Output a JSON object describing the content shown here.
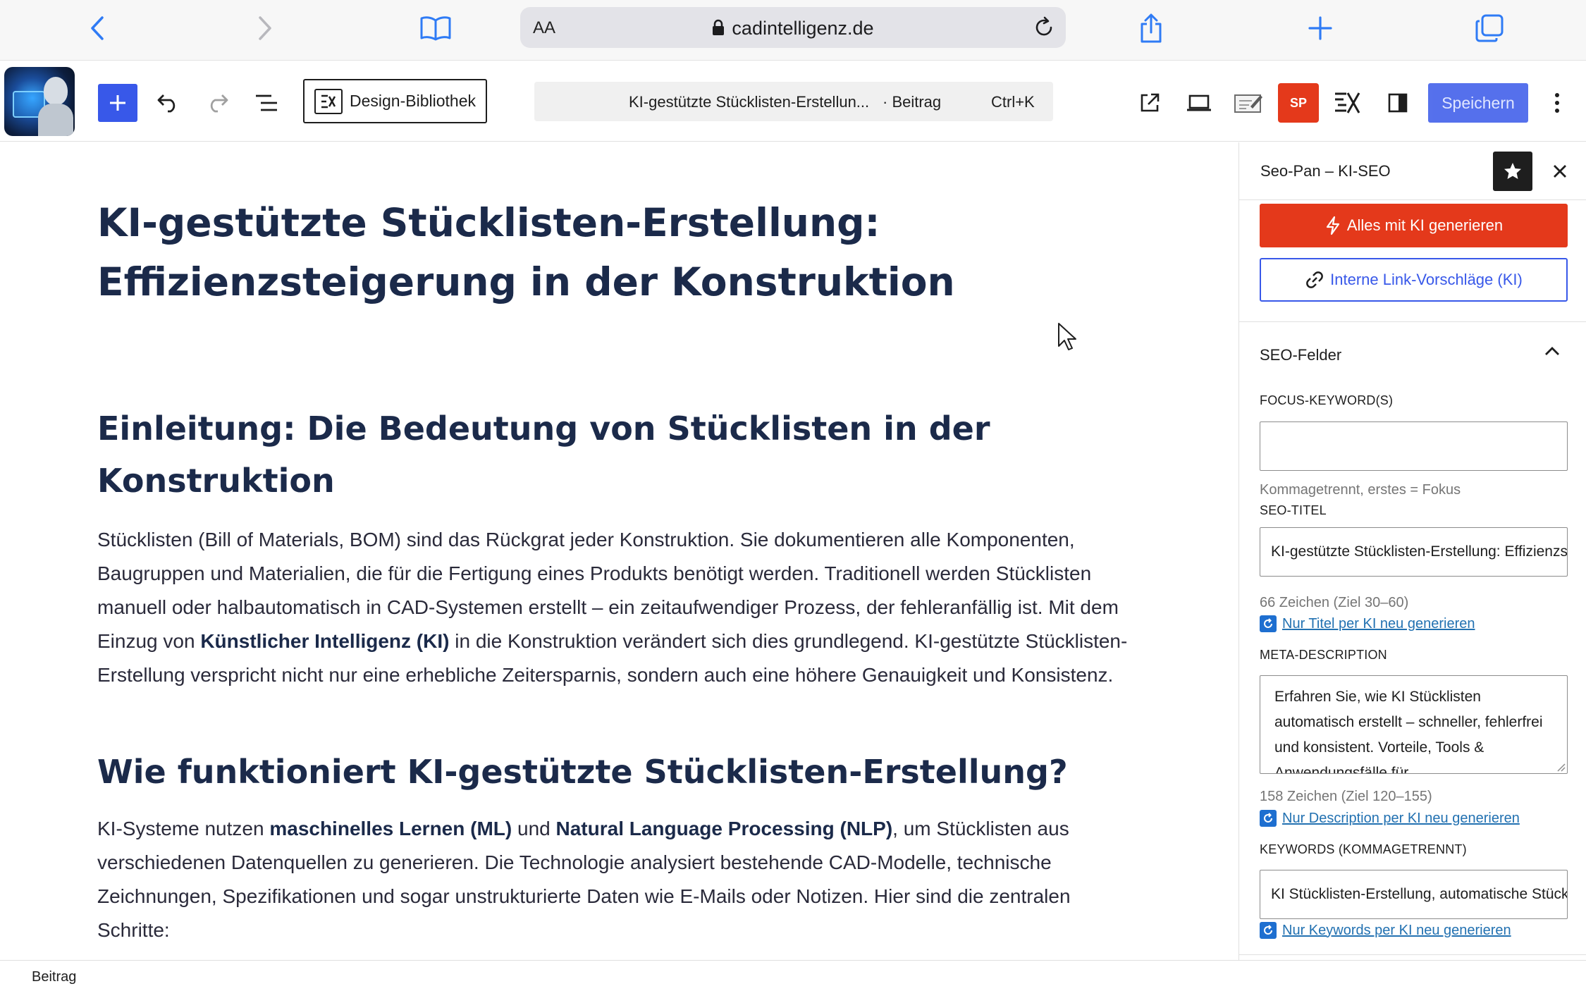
{
  "browser": {
    "url_text_size": "AA",
    "domain": "cadintelligenz.de"
  },
  "toolbar": {
    "design_library": "Design-Bibliothek",
    "command_title": "KI-gestützte Stücklisten-Erstellun...",
    "command_type": "· Beitrag",
    "command_shortcut": "Ctrl+K",
    "sp_badge": "SP",
    "save_label": "Speichern",
    "accent_color": "#3858e9",
    "sp_color": "#e4391b"
  },
  "content": {
    "title": "KI-gestützte Stücklisten-Erstellung: Effizienzsteigerung in der Konstruktion",
    "h2_intro": "Einleitung: Die Bedeutung von Stücklisten in der Konstruktion",
    "p1_a": "Stücklisten (Bill of Materials, BOM) sind das Rückgrat jeder Konstruktion. Sie dokumentieren alle Komponenten, Baugruppen und Materialien, die für die Fertigung eines Produkts benötigt werden. Traditionell werden Stücklisten manuell oder halbautomatisch in CAD-Systemen erstellt – ein zeitaufwendiger Prozess, der fehleranfällig ist. Mit dem Einzug von ",
    "p1_b": "Künstlicher Intelligenz (KI)",
    "p1_c": " in die Konstruktion verändert sich dies grundlegend. KI-gestützte Stücklisten-Erstellung verspricht nicht nur eine erhebliche Zeitersparnis, sondern auch eine höhere Genauigkeit und Konsistenz.",
    "h2_how": "Wie funktioniert KI-gestützte Stücklisten-Erstellung?",
    "p2_a": "KI-Systeme nutzen ",
    "p2_b": "maschinelles Lernen (ML)",
    "p2_c": " und ",
    "p2_d": "Natural Language Processing (NLP)",
    "p2_e": ", um Stücklisten aus verschiedenen Datenquellen zu generieren. Die Technologie analysiert bestehende CAD-Modelle, technische Zeichnungen, Spezifikationen und sogar unstrukturierte Daten wie E-Mails oder Notizen. Hier sind die zentralen Schritte:"
  },
  "sidebar": {
    "title": "Seo-Pan – KI-SEO",
    "generate_all": "Alles mit KI generieren",
    "internal_links": "Interne Link-Vorschläge (KI)",
    "panel_title": "SEO-Felder",
    "focus_label": "FOCUS-KEYWORD(S)",
    "focus_value": "",
    "focus_help": "Kommagetrennt, erstes = Fokus",
    "seo_title_label": "SEO-TITEL",
    "seo_title_value": "KI-gestützte Stücklisten-Erstellung: Effizienzsteigerung in der Konstruktion",
    "seo_title_count": "66 Zeichen (Ziel 30–60)",
    "seo_title_regen": "Nur Titel per KI neu generieren",
    "meta_label": "META-DESCRIPTION",
    "meta_value": "Erfahren Sie, wie KI Stücklisten automatisch erstellt – schneller, fehlerfrei und konsistent. Vorteile, Tools & Anwendungsfälle für",
    "meta_count": "158 Zeichen (Ziel 120–155)",
    "meta_regen": "Nur Description per KI neu generieren",
    "keywords_label": "KEYWORDS (KOMMAGETRENNT)",
    "keywords_value": "KI Stücklisten-Erstellung, automatische Stücklisten",
    "keywords_regen": "Nur Keywords per KI neu generieren"
  },
  "footer": {
    "breadcrumb": "Beitrag"
  }
}
